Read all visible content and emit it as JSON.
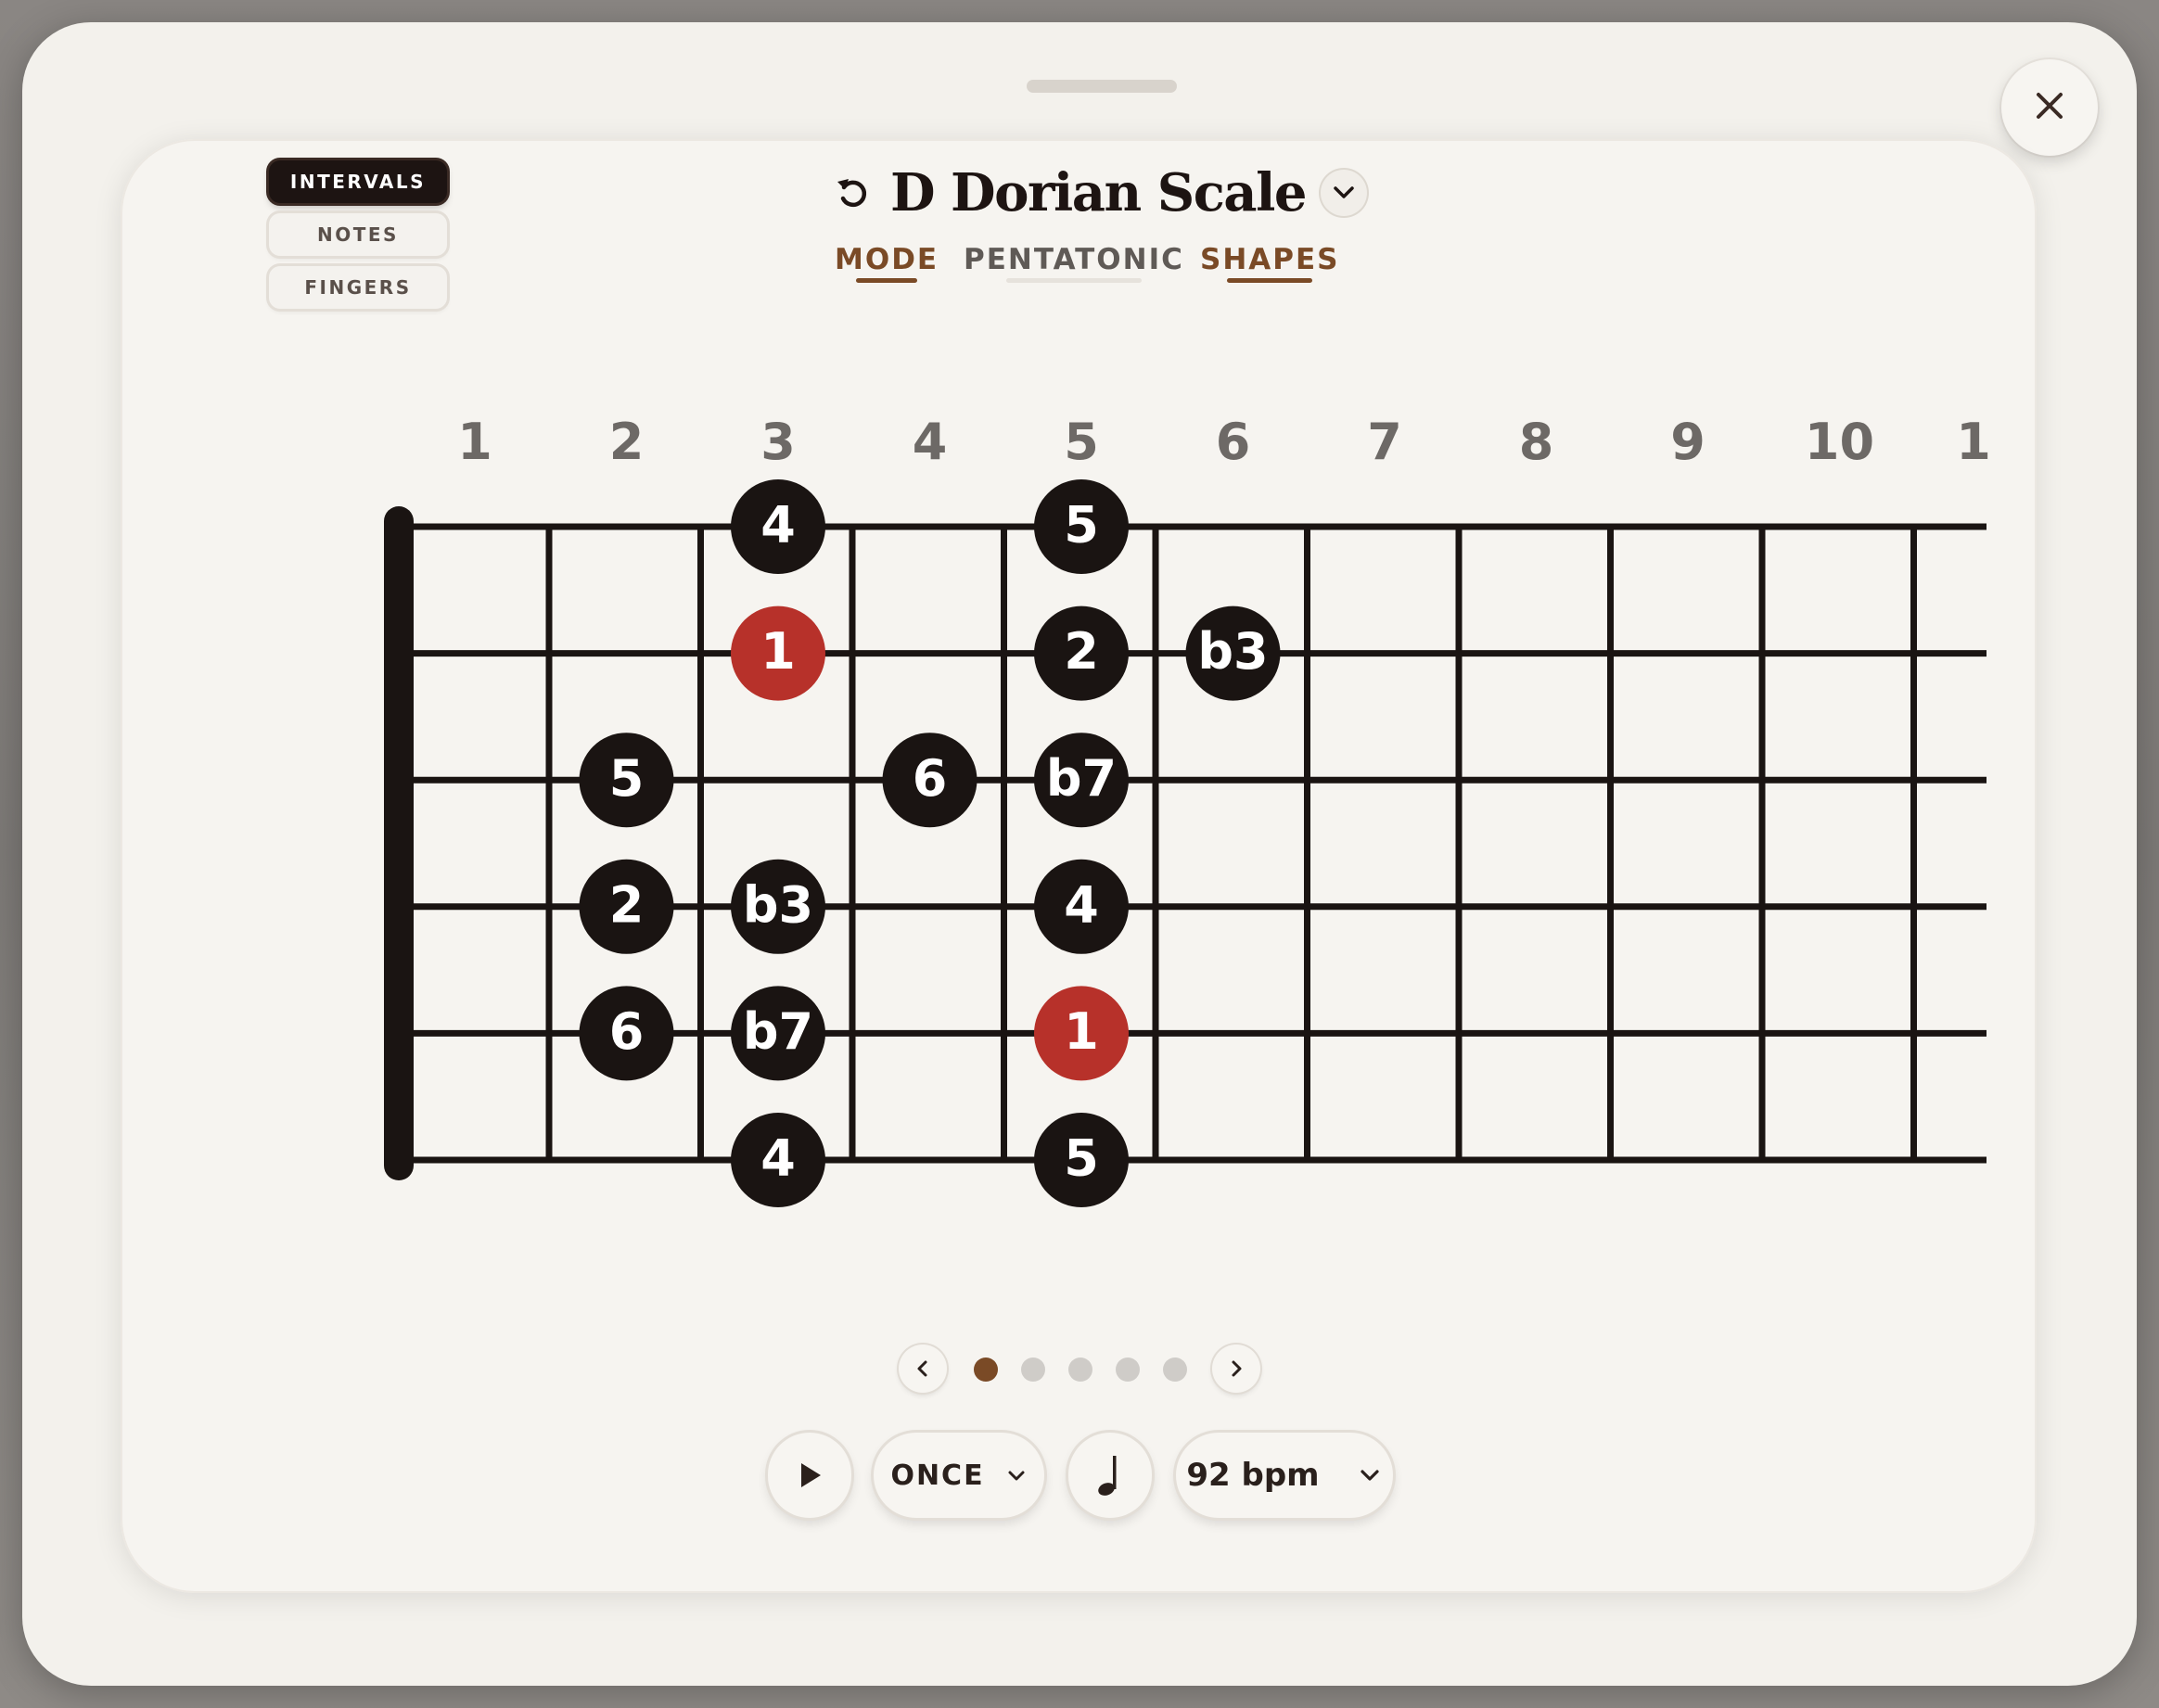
{
  "app": {
    "title": "D Dorian Scale",
    "accent_color": "#7a4a26",
    "root_color": "#b7312a",
    "note_color": "#1a1412"
  },
  "icons": {
    "undo": "undo-icon",
    "title_dropdown": "chevron-down-icon",
    "close": "close-icon",
    "prev": "chevron-left-icon",
    "next": "chevron-right-icon",
    "play": "play-icon",
    "metronome": "quarter-note-icon"
  },
  "display_modes": [
    {
      "label": "INTERVALS",
      "active": true
    },
    {
      "label": "NOTES",
      "active": false
    },
    {
      "label": "FINGERS",
      "active": false
    }
  ],
  "tabs": [
    {
      "label": "MODE",
      "active": true
    },
    {
      "label": "PENTATONIC",
      "active": false
    },
    {
      "label": "SHAPES",
      "active": true
    }
  ],
  "fretboard": {
    "fret_numbers": [
      "1",
      "2",
      "3",
      "4",
      "5",
      "6",
      "7",
      "8",
      "9",
      "10",
      "1"
    ],
    "notes": [
      {
        "string": 1,
        "fret": 3,
        "label": "4",
        "root": false
      },
      {
        "string": 1,
        "fret": 5,
        "label": "5",
        "root": false
      },
      {
        "string": 2,
        "fret": 3,
        "label": "1",
        "root": true
      },
      {
        "string": 2,
        "fret": 5,
        "label": "2",
        "root": false
      },
      {
        "string": 2,
        "fret": 6,
        "label": "b3",
        "root": false
      },
      {
        "string": 3,
        "fret": 2,
        "label": "5",
        "root": false
      },
      {
        "string": 3,
        "fret": 4,
        "label": "6",
        "root": false
      },
      {
        "string": 3,
        "fret": 5,
        "label": "b7",
        "root": false
      },
      {
        "string": 4,
        "fret": 2,
        "label": "2",
        "root": false
      },
      {
        "string": 4,
        "fret": 3,
        "label": "b3",
        "root": false
      },
      {
        "string": 4,
        "fret": 5,
        "label": "4",
        "root": false
      },
      {
        "string": 5,
        "fret": 2,
        "label": "6",
        "root": false
      },
      {
        "string": 5,
        "fret": 3,
        "label": "b7",
        "root": false
      },
      {
        "string": 5,
        "fret": 5,
        "label": "1",
        "root": true
      },
      {
        "string": 6,
        "fret": 3,
        "label": "4",
        "root": false
      },
      {
        "string": 6,
        "fret": 5,
        "label": "5",
        "root": false
      }
    ]
  },
  "pager": {
    "count": 5,
    "active": 1
  },
  "playback": {
    "repeat_label": "ONCE",
    "tempo_label": "92 bpm"
  }
}
